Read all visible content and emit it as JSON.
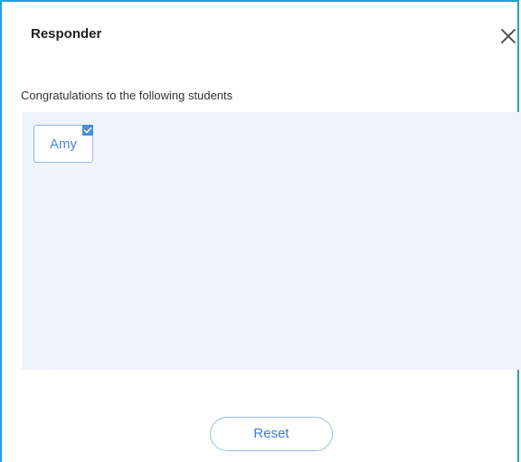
{
  "dialog": {
    "title": "Responder",
    "close_icon": "close-icon",
    "subtitle": "Congratulations to the following students",
    "students": [
      {
        "name": "Amy",
        "selected": true
      }
    ],
    "reset_label": "Reset"
  },
  "colors": {
    "border": "#1ea0df",
    "area_background": "#eef3fc",
    "accent": "#4a86d8"
  }
}
